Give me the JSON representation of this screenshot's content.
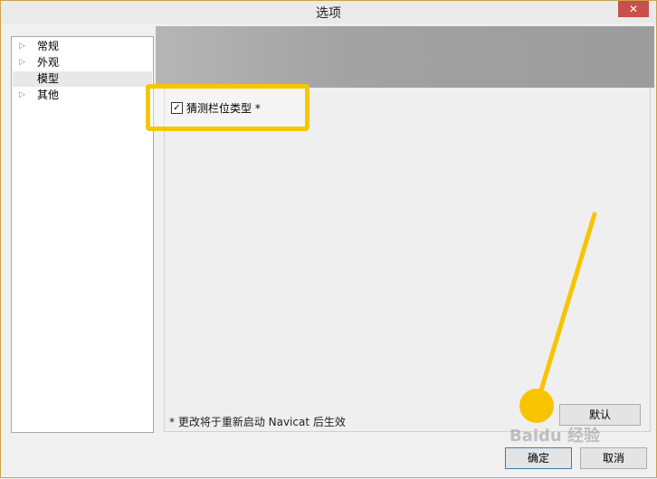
{
  "window": {
    "title": "选项",
    "close_glyph": "✕"
  },
  "tree": {
    "items": [
      {
        "label": "常规",
        "expandable": true,
        "arrow": "▷",
        "selected": false
      },
      {
        "label": "外观",
        "expandable": true,
        "arrow": "▷",
        "selected": false
      },
      {
        "label": "模型",
        "expandable": false,
        "arrow": "",
        "selected": true
      },
      {
        "label": "其他",
        "expandable": true,
        "arrow": "▷",
        "selected": false
      }
    ]
  },
  "options": {
    "guess_column_type": {
      "label": "猜测栏位类型 *",
      "checked": true,
      "check_glyph": "✓"
    }
  },
  "footer": {
    "note": "* 更改将于重新启动 Navicat 后生效",
    "default_label": "默认",
    "ok_label": "确定",
    "cancel_label": "取消"
  },
  "watermark": "Baidu 经验",
  "colors": {
    "highlight": "#f6c600",
    "close": "#c7504a"
  }
}
